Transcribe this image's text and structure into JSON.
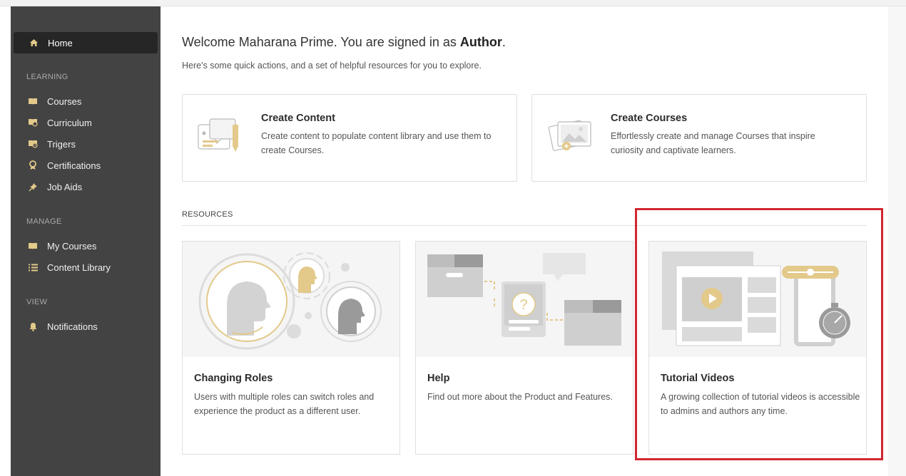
{
  "sidebar": {
    "home": "Home",
    "sections": [
      {
        "title": "LEARNING",
        "items": [
          "Courses",
          "Curriculum",
          "Trigers",
          "Certifications",
          "Job Aids"
        ]
      },
      {
        "title": "MANAGE",
        "items": [
          "My Courses",
          "Content Library"
        ]
      },
      {
        "title": "VIEW",
        "items": [
          "Notifications"
        ]
      }
    ]
  },
  "welcome": {
    "prefix": "Welcome Maharana Prime. You are signed in as ",
    "role": "Author",
    "suffix": ".",
    "subtitle": "Here's some quick actions, and a set of helpful resources for you to explore."
  },
  "actions": [
    {
      "title": "Create Content",
      "desc": "Create content to populate content library and use them to create Courses."
    },
    {
      "title": "Create Courses",
      "desc": "Effortlessly create and manage Courses that inspire curiosity and captivate learners."
    }
  ],
  "resources": {
    "title": "RESOURCES",
    "cards": [
      {
        "title": "Changing Roles",
        "desc": "Users with multiple roles can switch roles and experience the product as a different user."
      },
      {
        "title": "Help",
        "desc": "Find out more about the Product and Features."
      },
      {
        "title": "Tutorial Videos",
        "desc": "A growing collection of tutorial videos is accessible to admins and authors any time."
      }
    ]
  },
  "colors": {
    "accent": "#e3c98a",
    "sidebar": "#434343",
    "highlight": "#d22630"
  }
}
